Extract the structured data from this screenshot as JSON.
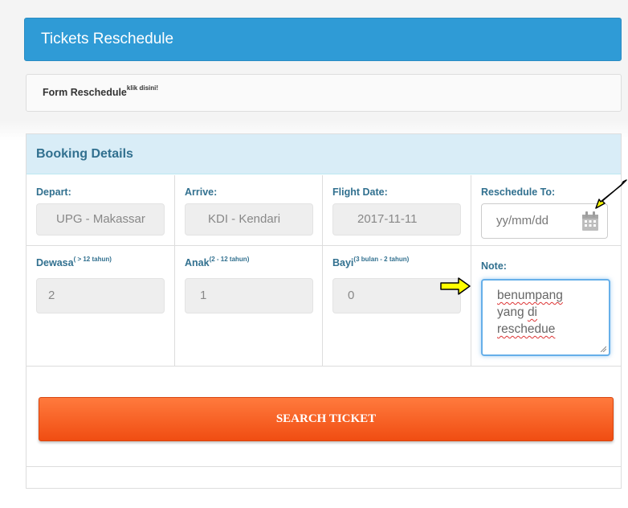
{
  "header": {
    "title": "Tickets Reschedule"
  },
  "form_link": {
    "label": "Form Reschedule",
    "sup": "klik disini!"
  },
  "panel": {
    "title": "Booking Details"
  },
  "fields": {
    "depart": {
      "label": "Depart:",
      "value": "UPG - Makassar"
    },
    "arrive": {
      "label": "Arrive:",
      "value": "KDI - Kendari"
    },
    "flight_date": {
      "label": "Flight Date:",
      "value": "2017-11-11"
    },
    "reschedule_to": {
      "label": "Reschedule To:",
      "placeholder": "yy/mm/dd"
    },
    "dewasa": {
      "label": "Dewasa",
      "sup": "( > 12 tahun)",
      "value": "2"
    },
    "anak": {
      "label": "Anak",
      "sup": "(2 - 12 tahun)",
      "value": "1"
    },
    "bayi": {
      "label": "Bayi",
      "sup": "(3 bulan - 2 tahun)",
      "value": "0"
    },
    "note": {
      "label": "Note:",
      "words": [
        "benumpang",
        "yang",
        "di",
        "reschedue"
      ]
    }
  },
  "search_button": {
    "label": "SEARCH TICKET"
  },
  "annotations": {
    "arrow_color": "#ffff00"
  }
}
